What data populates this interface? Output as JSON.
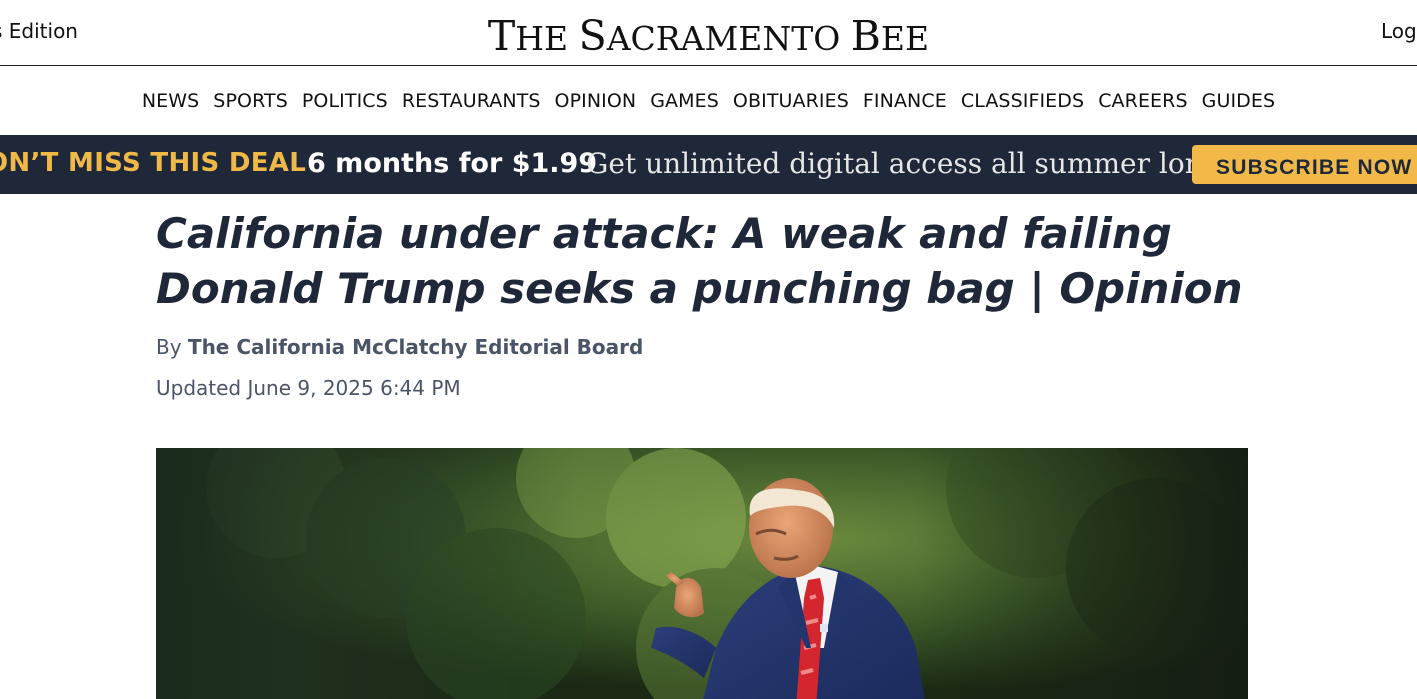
{
  "header": {
    "edition_label": "s Edition",
    "masthead": {
      "prefix_initial": "T",
      "prefix_rest": "HE ",
      "word1_initial": "S",
      "word1_rest": "ACRAMENTO ",
      "word2_initial": "B",
      "word2_rest": "EE"
    },
    "login_label": "Log"
  },
  "nav": {
    "items": [
      "NEWS",
      "SPORTS",
      "POLITICS",
      "RESTAURANTS",
      "OPINION",
      "GAMES",
      "OBITUARIES",
      "FINANCE",
      "CLASSIFIEDS",
      "CAREERS",
      "GUIDES"
    ]
  },
  "promo": {
    "deal_label": "ON’T MISS THIS DEAL",
    "price_label": "6 months for $1.99",
    "tagline": "Get unlimited digital access all summer long.",
    "button_label": "SUBSCRIBE NOW",
    "colors": {
      "background": "#1e2838",
      "accent": "#f2b848"
    }
  },
  "article": {
    "headline": "California under attack: A weak and failing Donald Trump seeks a punching bag | Opinion",
    "by_prefix": "By",
    "author": "The California McClatchy Editorial Board",
    "updated": "Updated June 9, 2025 6:44 PM"
  },
  "photo": {
    "subject": "man-in-suit-pointing-photo"
  }
}
